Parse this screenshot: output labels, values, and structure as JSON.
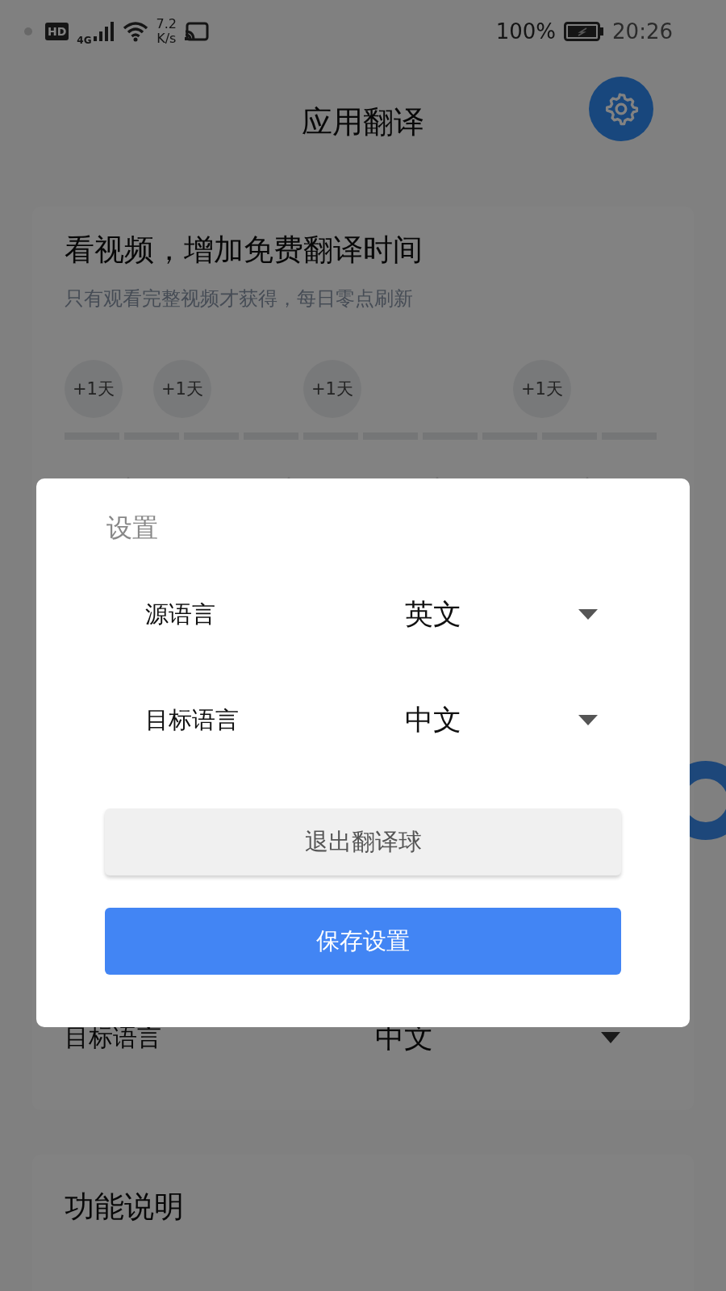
{
  "status_bar": {
    "hd_badge": "HD",
    "network": "4G",
    "speed_value": "7.2",
    "speed_unit": "K/s",
    "battery": "100%",
    "time": "20:26"
  },
  "header": {
    "title": "应用翻译"
  },
  "video_card": {
    "title": "看视频，增加免费翻译时间",
    "subtitle": "只有观看完整视频才获得，每日零点刷新",
    "rewards": [
      "+1天",
      "+1天",
      "+1天",
      "+1天"
    ],
    "segments": [
      {
        "filled": false
      },
      {
        "filled": false
      },
      {
        "filled": false
      },
      {
        "filled": false
      },
      {
        "filled": false
      },
      {
        "filled": false
      },
      {
        "filled": false
      },
      {
        "filled": false
      },
      {
        "filled": false
      },
      {
        "filled": false
      }
    ],
    "language_rows": [
      {
        "label": "目标语言",
        "value": "中文"
      }
    ]
  },
  "features_card": {
    "title": "功能说明"
  },
  "dialog": {
    "title": "设置",
    "rows": [
      {
        "label": "源语言",
        "value": "英文"
      },
      {
        "label": "目标语言",
        "value": "中文"
      }
    ],
    "buttons": [
      {
        "label": "退出翻译球",
        "kind": "secondary"
      },
      {
        "label": "保存设置",
        "kind": "primary"
      }
    ]
  }
}
